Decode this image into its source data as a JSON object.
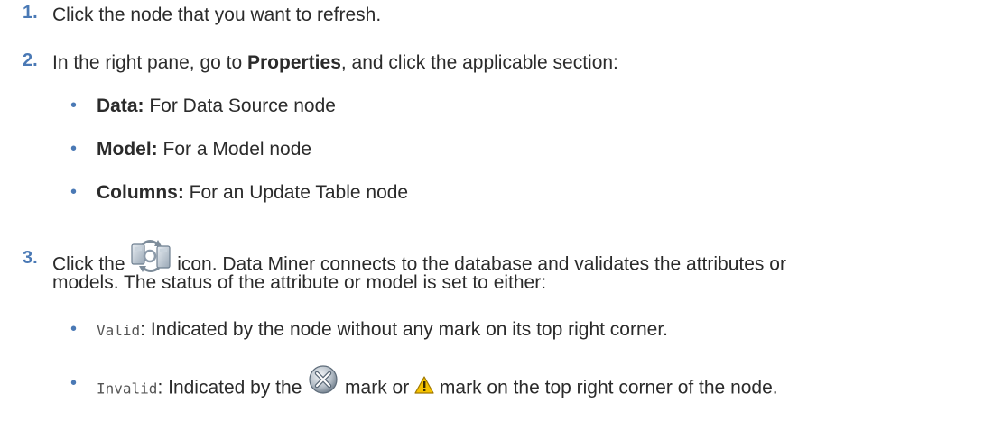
{
  "steps": [
    {
      "number": "1.",
      "text": "Click the node that you want to refresh."
    },
    {
      "number": "2.",
      "text_before": "In the right pane, go to ",
      "bold": "Properties",
      "text_after": ", and click the applicable section:",
      "bullets": [
        {
          "label": "Data:",
          "text": " For Data Source node"
        },
        {
          "label": "Model:",
          "text": " For a Model node"
        },
        {
          "label": "Columns:",
          "text": " For an Update Table node"
        }
      ]
    },
    {
      "number": "3.",
      "text_before": "Click the ",
      "text_after": " icon. Data Miner connects to the database and validates the attributes or",
      "line2": "models. The status of the attribute or model is set to either:",
      "bullets": [
        {
          "code": "Valid",
          "text": ": Indicated by the node without any mark on its top right corner."
        },
        {
          "code": "Invalid",
          "text_before": ": Indicated by the ",
          "text_mid": " mark or ",
          "text_after": " mark on the top right corner of the node."
        }
      ]
    }
  ],
  "icons": {
    "refresh": "refresh-icon",
    "error": "error-x-icon",
    "warning": "warning-icon"
  },
  "colors": {
    "accent": "#4a79b5",
    "text": "#2b2b2b",
    "warning": "#f5c200"
  }
}
